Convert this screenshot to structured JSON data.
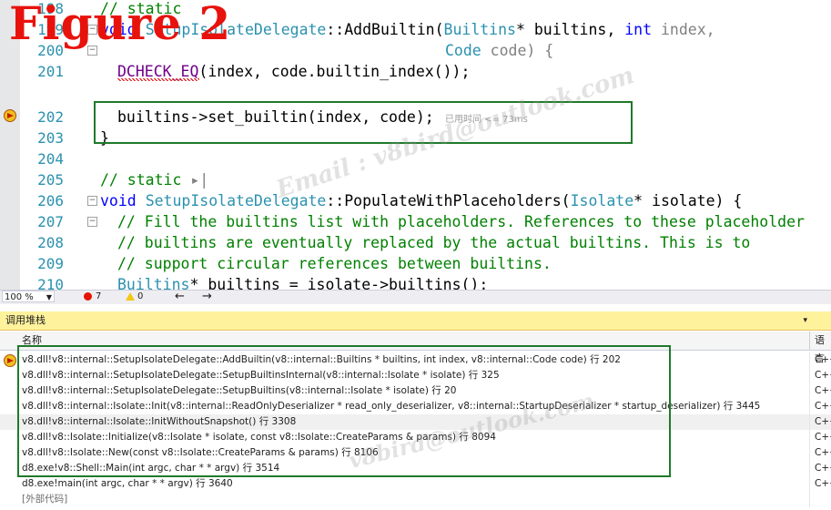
{
  "figure_label": "Figure 2",
  "editor": {
    "lines": [
      {
        "num": "198",
        "code": ""
      },
      {
        "num": "199",
        "code": ""
      },
      {
        "num": "200",
        "code": ""
      },
      {
        "num": "201",
        "code": ""
      },
      {
        "num": "202",
        "code": ""
      },
      {
        "num": "203",
        "code": ""
      },
      {
        "num": "204",
        "code": ""
      },
      {
        "num": "205",
        "code": ""
      },
      {
        "num": "206",
        "code": ""
      },
      {
        "num": "207",
        "code": ""
      },
      {
        "num": "208",
        "code": ""
      },
      {
        "num": "209",
        "code": ""
      },
      {
        "num": "210",
        "code": ""
      }
    ],
    "elapsed_hint": "已用时间 <= 73ms",
    "tokens": {
      "l198_comment": "// static",
      "l199_void": "void",
      "l199_cls": "SetupIsolateDelegate",
      "l199_sep": "::AddBuiltin(",
      "l199_t1": "Builtins",
      "l199_p1": "* builtins, ",
      "l199_int": "int",
      "l199_p2": " index,",
      "l200_type": "Code",
      "l200_rest": " code) {",
      "l201_macro": "DCHECK_EQ",
      "l201_rest": "(index, code.builtin_index());",
      "l202_code": "builtins->set_builtin(index, code);",
      "l203_code": "}",
      "l205_comment": "// static",
      "l206_void": "void",
      "l206_cls": "SetupIsolateDelegate",
      "l206_sep": "::PopulateWithPlaceholders(",
      "l206_type": "Isolate",
      "l206_rest": "* isolate) {",
      "l207_comment": "// Fill the builtins list with placeholders. References to these placeholder",
      "l208_comment": "// builtins are eventually replaced by the actual builtins. This is to",
      "l209_comment": "// support circular references between builtins.",
      "l210_type": "Builtins",
      "l210_rest": "* builtins = isolate->builtins();"
    }
  },
  "statusbar": {
    "zoom": "100 %",
    "errors": "7",
    "warnings": "0",
    "nav_back": "←",
    "nav_forward": "→"
  },
  "callstack": {
    "title": "调用堆栈",
    "pin": "▾",
    "col_name": "名称",
    "col_lang": "语言",
    "rows": [
      {
        "frame": "v8.dll!v8::internal::SetupIsolateDelegate::AddBuiltin(v8::internal::Builtins * builtins, int index, v8::internal::Code code) 行 202",
        "lang": "C++"
      },
      {
        "frame": "v8.dll!v8::internal::SetupIsolateDelegate::SetupBuiltinsInternal(v8::internal::Isolate * isolate) 行 325",
        "lang": "C++"
      },
      {
        "frame": "v8.dll!v8::internal::SetupIsolateDelegate::SetupBuiltins(v8::internal::Isolate * isolate) 行 20",
        "lang": "C++"
      },
      {
        "frame": "v8.dll!v8::internal::Isolate::Init(v8::internal::ReadOnlyDeserializer * read_only_deserializer, v8::internal::StartupDeserializer * startup_deserializer) 行 3445",
        "lang": "C++"
      },
      {
        "frame": "v8.dll!v8::internal::Isolate::InitWithoutSnapshot() 行 3308",
        "lang": "C++"
      },
      {
        "frame": "v8.dll!v8::Isolate::Initialize(v8::Isolate * isolate, const v8::Isolate::CreateParams & params) 行 8094",
        "lang": "C++"
      },
      {
        "frame": "v8.dll!v8::Isolate::New(const v8::Isolate::CreateParams & params) 行 8106",
        "lang": "C++"
      },
      {
        "frame": "d8.exe!v8::Shell::Main(int argc, char * * argv) 行 3514",
        "lang": "C++"
      },
      {
        "frame": "d8.exe!main(int argc, char * * argv) 行 3640",
        "lang": "C++"
      },
      {
        "frame": "[外部代码]",
        "lang": ""
      }
    ]
  },
  "watermark": {
    "line1": "Email : v8bird@outlook.com",
    "line2": "v8bird@outlook.com"
  },
  "colors": {
    "figure_label": "#e8120c",
    "highlight_box": "#1f7a2a",
    "panel_title_bg": "#fff29d",
    "keyword": "#0000ff",
    "type": "#2b91af",
    "comment": "#008000"
  }
}
